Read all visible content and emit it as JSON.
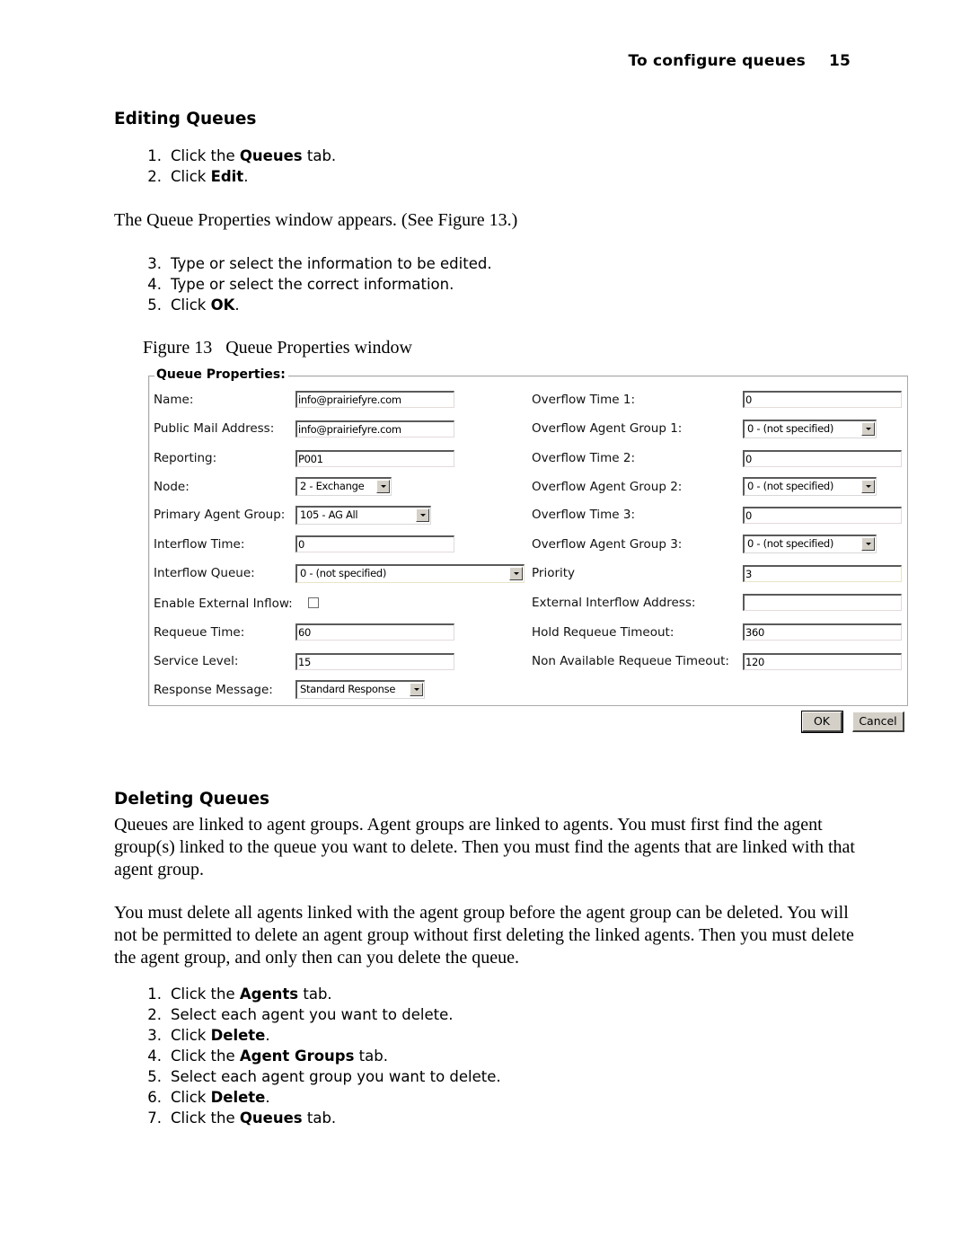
{
  "running_head": {
    "title": "To configure queues",
    "page_number": "15"
  },
  "editing": {
    "heading": "Editing Queues",
    "steps_a": [
      {
        "num": "1.",
        "pre": "Click the ",
        "bold": "Queues",
        "post": " tab."
      },
      {
        "num": "2.",
        "pre": "Click ",
        "bold": "Edit",
        "post": "."
      }
    ],
    "paragraph": "The Queue Properties window appears. (See Figure 13.)",
    "steps_b": [
      {
        "num": "3.",
        "pre": "Type or select the information to be edited.",
        "bold": "",
        "post": ""
      },
      {
        "num": "4.",
        "pre": "Type or select the correct information.",
        "bold": "",
        "post": ""
      },
      {
        "num": "5.",
        "pre": "Click ",
        "bold": "OK",
        "post": "."
      }
    ],
    "figure_caption": "Figure 13   Queue Properties window"
  },
  "dialog": {
    "legend": "Queue Properties:",
    "left": {
      "name": {
        "label": "Name:",
        "value": "info@prairiefyre.com"
      },
      "public_mail": {
        "label": "Public Mail Address:",
        "value": "info@prairiefyre.com"
      },
      "reporting": {
        "label": "Reporting:",
        "value": "P001"
      },
      "node": {
        "label": "Node:",
        "value": "2 - Exchange"
      },
      "primary_agent_group": {
        "label": "Primary Agent Group:",
        "value": "105 - AG All"
      },
      "interflow_time": {
        "label": "Interflow Time:",
        "value": "0"
      },
      "interflow_queue": {
        "label": "Interflow Queue:",
        "value": "0 - (not specified)"
      },
      "enable_external_inflow": {
        "label": "Enable External Inflow:",
        "checked": false
      },
      "requeue_time": {
        "label": "Requeue Time:",
        "value": "60"
      },
      "service_level": {
        "label": "Service Level:",
        "value": "15"
      },
      "response_message": {
        "label": "Response Message:",
        "value": "Standard Response"
      }
    },
    "right": {
      "overflow_time_1": {
        "label": "Overflow Time 1:",
        "value": "0"
      },
      "overflow_agent_group_1": {
        "label": "Overflow Agent Group 1:",
        "value": "0 - (not specified)"
      },
      "overflow_time_2": {
        "label": "Overflow Time 2:",
        "value": "0"
      },
      "overflow_agent_group_2": {
        "label": "Overflow Agent Group 2:",
        "value": "0 - (not specified)"
      },
      "overflow_time_3": {
        "label": "Overflow Time 3:",
        "value": "0"
      },
      "overflow_agent_group_3": {
        "label": "Overflow Agent Group 3:",
        "value": "0 - (not specified)"
      },
      "priority": {
        "label": "Priority",
        "value": "3"
      },
      "external_interflow_address": {
        "label": "External Interflow Address:",
        "value": ""
      },
      "hold_requeue_timeout": {
        "label": "Hold Requeue Timeout:",
        "value": "360"
      },
      "non_available_requeue_timeout": {
        "label": "Non Available Requeue Timeout:",
        "value": "120"
      }
    },
    "buttons": {
      "ok": "OK",
      "cancel": "Cancel"
    }
  },
  "deleting": {
    "heading": "Deleting Queues",
    "paragraph_1": "Queues are linked to agent groups. Agent groups are linked to agents. You must first find the agent group(s) linked to the queue you want to delete. Then you must find the agents that are linked with that agent group.",
    "paragraph_2": "You must delete all agents linked with the agent group before the agent group can be deleted. You will not be permitted to delete an agent group without first deleting the linked agents. Then you must delete the agent group, and only then can you delete the queue.",
    "steps": [
      {
        "num": "1.",
        "pre": "Click the ",
        "bold": "Agents",
        "post": " tab."
      },
      {
        "num": "2.",
        "pre": "Select each agent you want to delete.",
        "bold": "",
        "post": ""
      },
      {
        "num": "3.",
        "pre": "Click ",
        "bold": "Delete",
        "post": "."
      },
      {
        "num": "4.",
        "pre": "Click the ",
        "bold": "Agent Groups",
        "post": " tab."
      },
      {
        "num": "5.",
        "pre": "Select each agent group you want to delete.",
        "bold": "",
        "post": ""
      },
      {
        "num": "6.",
        "pre": "Click ",
        "bold": "Delete",
        "post": "."
      },
      {
        "num": "7.",
        "pre": "Click the ",
        "bold": "Queues",
        "post": " tab."
      }
    ]
  }
}
